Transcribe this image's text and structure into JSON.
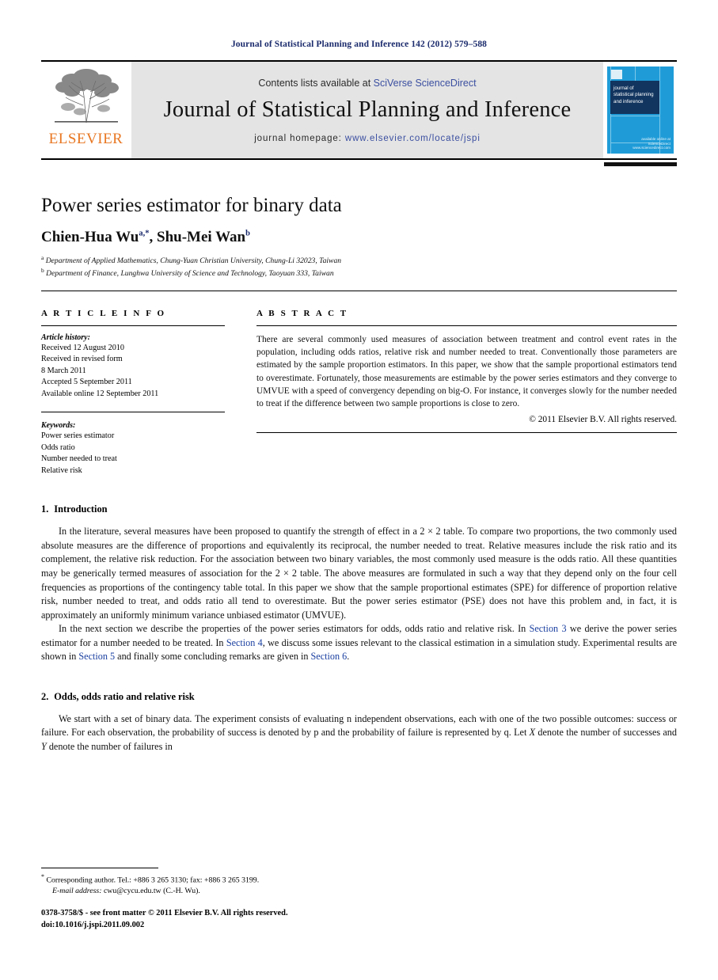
{
  "running_head": "Journal of Statistical Planning and Inference 142 (2012) 579–588",
  "masthead": {
    "publisher_name": "ELSEVIER",
    "contents_prefix": "Contents lists available at ",
    "contents_link": "SciVerse ScienceDirect",
    "journal_title": "Journal of Statistical Planning and Inference",
    "homepage_prefix": "journal homepage: ",
    "homepage_link": "www.elsevier.com/locate/jspi",
    "cover": {
      "title_lines": "journal of\nstatistical planning\nand inference",
      "sciencedirect_label": "available online at\nScienceDirect\nwww.sciencedirect.com"
    }
  },
  "article": {
    "title": "Power series estimator for binary data",
    "authors": [
      {
        "name": "Chien-Hua Wu",
        "marks": "a,*"
      },
      {
        "name": "Shu-Mei Wan",
        "marks": "b"
      }
    ],
    "authors_separator": ", ",
    "affiliations": [
      {
        "mark": "a",
        "text": "Department of Applied Mathematics, Chung-Yuan Christian University, Chung-Li 32023, Taiwan"
      },
      {
        "mark": "b",
        "text": "Department of Finance, Lunghwa University of Science and Technology, Taoyuan 333, Taiwan"
      }
    ]
  },
  "info": {
    "heading": "A R T I C L E  I N F O",
    "history_label": "Article history:",
    "history_lines": [
      "Received 12 August 2010",
      "Received in revised form",
      "8 March 2011",
      "Accepted 5 September 2011",
      "Available online 12 September 2011"
    ],
    "keywords_label": "Keywords:",
    "keywords": [
      "Power series estimator",
      "Odds ratio",
      "Number needed to treat",
      "Relative risk"
    ]
  },
  "abstract": {
    "heading": "A B S T R A C T",
    "text": "There are several commonly used measures of association between treatment and control event rates in the population, including odds ratios, relative risk and number needed to treat. Conventionally those parameters are estimated by the sample proportion estimators. In this paper, we show that the sample proportional estimators tend to overestimate. Fortunately, those measurements are estimable by the power series estimators and they converge to UMVUE with a speed of convergency depending on big-O. For instance, it converges slowly for the number needed to treat if the difference between two sample proportions is close to zero.",
    "copyright": "© 2011 Elsevier B.V. All rights reserved."
  },
  "sections": [
    {
      "number": "1.",
      "title": "Introduction"
    },
    {
      "number": "2.",
      "title": "Odds, odds ratio and relative risk"
    }
  ],
  "body": {
    "intro_p1_a": "In the literature, several measures have been proposed to quantify the strength of effect in a 2 × 2 table. To compare two proportions, the two commonly used absolute measures are the difference of proportions and equivalently its reciprocal, the number needed to treat. Relative measures include the risk ratio and its complement, the relative risk reduction. For the association between two binary variables, the most commonly used measure is the odds ratio. All these quantities may be generically termed measures of association for the 2 × 2 table. The above measures are formulated in such a way that they depend only on the four cell frequencies as proportions of the contingency table total. In this paper we show that the sample proportional estimates (SPE) for difference of proportion relative risk, number needed to treat, and odds ratio all tend to overestimate. But the power series estimator (PSE) does not have this problem and, in fact, it is approximately an uniformly minimum variance unbiased estimator (UMVUE).",
    "intro_p2_a": "In the next section we describe the properties of the power series estimators for odds, odds ratio and relative risk. In ",
    "intro_p2_link1": "Section 3",
    "intro_p2_b": " we derive the power series estimator for a number needed to be treated. In ",
    "intro_p2_link2": "Section 4",
    "intro_p2_c": ", we discuss some issues relevant to the classical estimation in a simulation study. Experimental results are shown in ",
    "intro_p2_link3": "Section 5",
    "intro_p2_d": " and finally some concluding remarks are given in ",
    "intro_p2_link4": "Section 6",
    "intro_p2_e": ".",
    "sec2_p1_a": "We start with a set of binary data. The experiment consists of evaluating n independent observations, each with one of the two possible outcomes: success or failure. For each observation, the probability of success is denoted by p and the probability of failure is represented by q. Let ",
    "sec2_var_x": "X",
    "sec2_p1_b": " denote the number of successes and ",
    "sec2_var_y": "Y",
    "sec2_p1_c": " denote the number of failures in"
  },
  "footer": {
    "corresponding": "Corresponding author. Tel.: +886 3 265 3130; fax: +886 3 265 3199.",
    "email_label": "E-mail address:",
    "email_value": " cwu@cycu.edu.tw (C.-H. Wu).",
    "issn_line": "0378-3758/$ - see front matter © 2011 Elsevier B.V. All rights reserved.",
    "doi_line": "doi:10.1016/j.jspi.2011.09.002"
  },
  "colors": {
    "link_blue": "#1a3fa0",
    "running_head_navy": "#1a2a6c",
    "elsevier_orange": "#e87722",
    "cover_blue": "#1f9cd8",
    "band_grey": "#e4e4e4"
  }
}
